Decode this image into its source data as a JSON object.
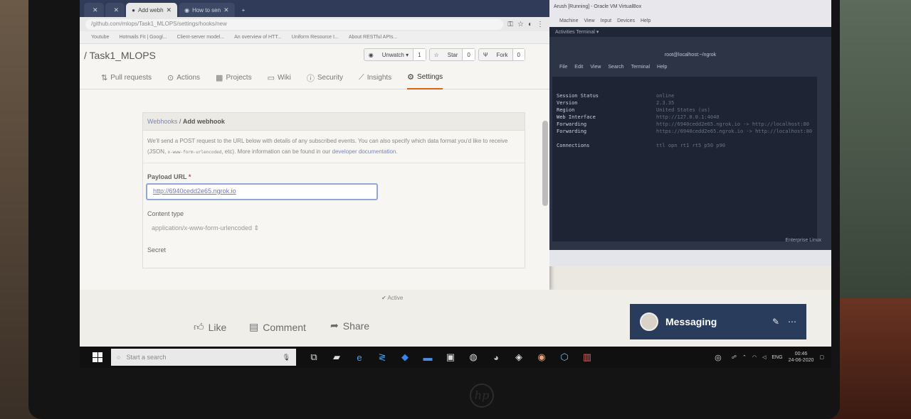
{
  "chrome": {
    "tabs": [
      {
        "label": "",
        "active": false
      },
      {
        "label": "",
        "active": false
      },
      {
        "label": "Add webh",
        "active": true
      },
      {
        "label": "How to sen",
        "active": false
      }
    ],
    "new_tab": "+",
    "url": "/github.com/mlops/Task1_MLOPS/settings/hooks/new",
    "bookmarks": [
      "Youtube",
      "Hotmails Fit | Googl...",
      "Client-server model...",
      "An overview of HTT...",
      "Uniform Resource I...",
      "About RESTful APIs..."
    ]
  },
  "repo": {
    "name": "/ Task1_MLOPS",
    "watch_label": "Unwatch ▾",
    "watch_count": "1",
    "star_label": "Star",
    "star_count": "0",
    "fork_label": "Fork",
    "fork_count": "0"
  },
  "nav": {
    "pull_requests": "Pull requests",
    "actions": "Actions",
    "projects": "Projects",
    "wiki": "Wiki",
    "security": "Security",
    "insights": "Insights",
    "settings": "Settings"
  },
  "webhook": {
    "crumb": "Webhooks",
    "sep": " / ",
    "title": "Add webhook",
    "desc_1": "We'll send a POST request to the URL below with details of any subscribed events. You can also specify which data format you'd like to receive (JSON, ",
    "desc_code": "x-www-form-urlencoded",
    "desc_2": ", etc). More information can be found in our ",
    "desc_link": "developer documentation",
    "desc_end": ".",
    "payload_label": "Payload URL",
    "payload_req": "*",
    "payload_value": "http://6940cedd2e65.ngrok.io",
    "content_type_label": "Content type",
    "content_type_value": "application/x-www-form-urlencoded ⇕",
    "secret_label": "Secret"
  },
  "vbox": {
    "title": "Arush [Running] - Oracle VM VirtualBox",
    "menu": [
      "Machine",
      "View",
      "Input",
      "Devices",
      "Help"
    ],
    "top": "Activities    Terminal ▾",
    "term_title": "root@localhost:~/ngrok",
    "term_menu": [
      "File",
      "Edit",
      "View",
      "Search",
      "Terminal",
      "Help"
    ],
    "rows": [
      {
        "k": "Session Status",
        "v": "online"
      },
      {
        "k": "Version",
        "v": "2.3.35"
      },
      {
        "k": "Region",
        "v": "United States (us)"
      },
      {
        "k": "Web Interface",
        "v": "http://127.0.0.1:4040"
      },
      {
        "k": "Forwarding",
        "v": "http://6940cedd2e65.ngrok.io -> http://localhost:80"
      },
      {
        "k": "Forwarding",
        "v": "https://6940cedd2e65.ngrok.io -> http://localhost:80"
      },
      {
        "k": "",
        "v": ""
      },
      {
        "k": "Connections",
        "v": "ttl  opn  rt1  rt5  p50  p90"
      }
    ],
    "status": "Enterprise Linux"
  },
  "linkedin": {
    "active": "✔ Active",
    "like": "Like",
    "comment": "Comment",
    "share": "Share",
    "messaging": "Messaging"
  },
  "taskbar": {
    "search": "Start a search",
    "lang": "ENG",
    "time": "00:46",
    "date": "24-06-2020"
  }
}
